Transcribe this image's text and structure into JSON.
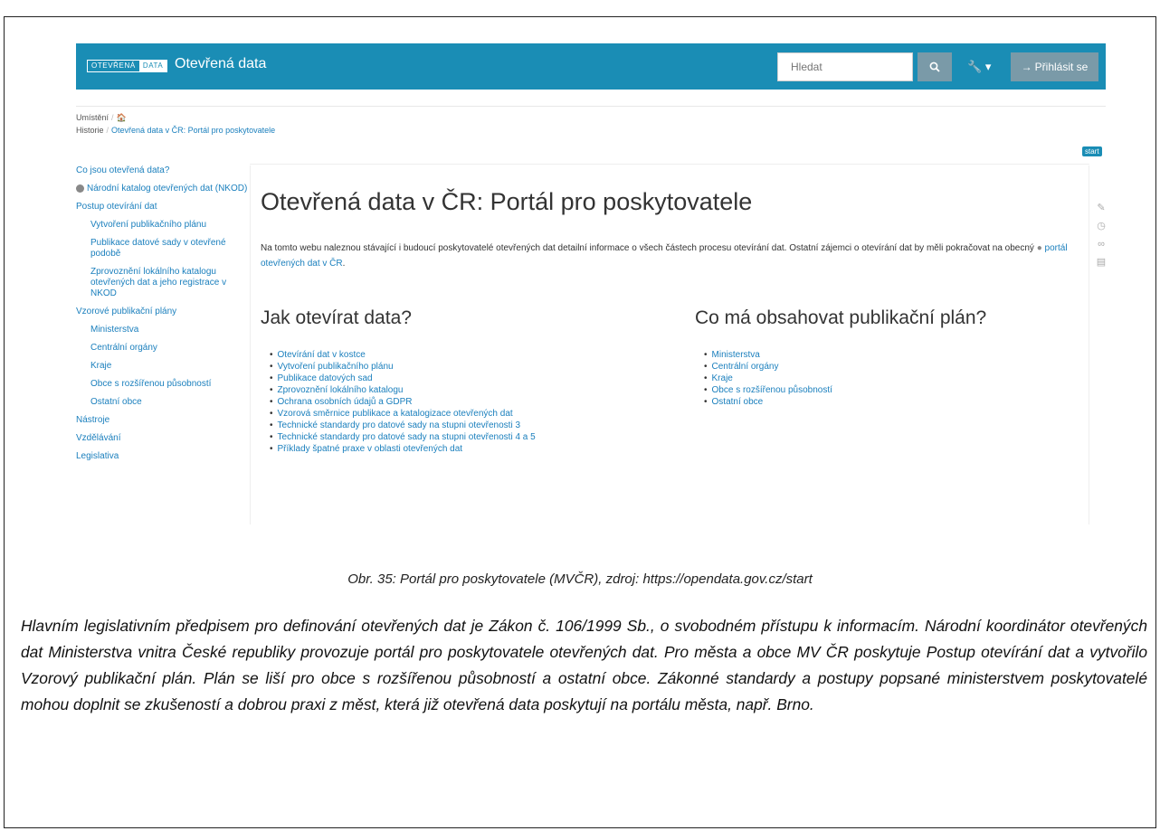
{
  "navbar": {
    "brand_part1": "OTEVŘENÁ",
    "brand_part2": "DATA",
    "title": "Otevřená data",
    "search_placeholder": "Hledat",
    "tools_label": "▾",
    "login_label": "Přihlásit se",
    "accent_color": "#1a8db5"
  },
  "breadcrumbs": {
    "location_label": "Umístění",
    "history_label": "Historie",
    "current_page": "Otevřená data v ČR: Portál pro poskytovatele"
  },
  "start_badge": "start",
  "sidebar": {
    "items": [
      {
        "label": "Co jsou otevřená data?"
      },
      {
        "label": "Národní katalog otevřených dat (NKOD)"
      },
      {
        "label": "Postup otevírání dat"
      },
      {
        "label": "Vytvoření publikačního plánu"
      },
      {
        "label": "Publikace datové sady v otevřené podobě"
      },
      {
        "label": "Zprovoznění lokálního katalogu otevřených dat a jeho registrace v NKOD"
      },
      {
        "label": "Vzorové publikační plány"
      },
      {
        "label": "Ministerstva"
      },
      {
        "label": "Centrální orgány"
      },
      {
        "label": "Kraje"
      },
      {
        "label": "Obce s rozšířenou působností"
      },
      {
        "label": "Ostatní obce"
      },
      {
        "label": "Nástroje"
      },
      {
        "label": "Vzdělávání"
      },
      {
        "label": "Legislativa"
      }
    ]
  },
  "main": {
    "title": "Otevřená data v ČR: Portál pro poskytovatele",
    "intro_text": "Na tomto webu naleznou stávající i budoucí poskytovatelé otevřených dat detailní informace o všech částech procesu otevírání dat. Ostatní zájemci o otevírání dat by měli pokračovat na obecný",
    "intro_link": "portál otevřených dat v ČR",
    "intro_end": ".",
    "left_heading": "Jak otevírat data?",
    "left_links": [
      "Otevírání dat v kostce",
      "Vytvoření publikačního plánu",
      "Publikace datových sad",
      "Zprovoznění lokálního katalogu",
      "Ochrana osobních údajů a GDPR",
      "Vzorová směrnice publikace a katalogizace otevřených dat",
      "Technické standardy pro datové sady na stupni otevřenosti 3",
      "Technické standardy pro datové sady na stupni otevřenosti 4 a 5",
      "Příklady špatné praxe v oblasti otevřených dat"
    ],
    "right_heading": "Co má obsahovat publikační plán?",
    "right_links": [
      "Ministerstva",
      "Centrální orgány",
      "Kraje",
      "Obce s rozšířenou působností",
      "Ostatní obce"
    ]
  },
  "caption": "Obr. 35: Portál pro poskytovatele (MVČR), zdroj: https://opendata.gov.cz/start",
  "paragraph": "Hlavním legislativním předpisem pro definování otevřených dat je Zákon č. 106/1999 Sb., o svobodném přístupu k informacím. Národní koordinátor otevřených dat Ministerstva vnitra České republiky provozuje portál pro poskytovatele otevřených dat. Pro města a obce MV ČR poskytuje Postup otevírání dat a vytvořilo Vzorový publikační plán. Plán se liší pro obce s rozšířenou působností a ostatní obce. Zákonné standardy a postupy popsané ministerstvem poskytovatelé mohou doplnit se zkušeností a dobrou praxi z měst, která již otevřená data poskytují na portálu města, např. Brno."
}
